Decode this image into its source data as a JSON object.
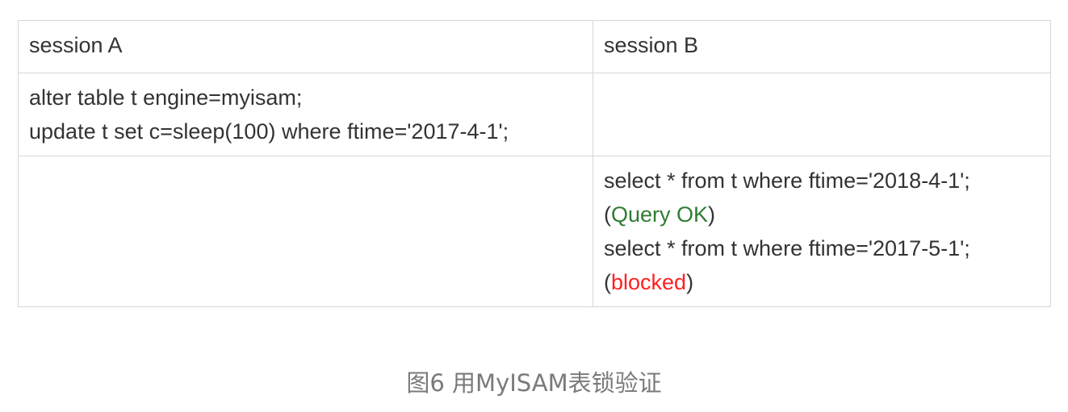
{
  "table": {
    "headers": [
      "session A",
      "session B"
    ],
    "row1": {
      "session_a": [
        "alter table t engine=myisam;",
        "update t set c=sleep(100)  where ftime='2017-4-1';"
      ],
      "session_b": []
    },
    "row2": {
      "session_a": [],
      "session_b": {
        "query1": "select * from t where  ftime='2018-4-1';",
        "result1": {
          "open": "(",
          "status": "Query OK",
          "close": ")"
        },
        "query2": "select * from t where  ftime='2017-5-1';",
        "result2": {
          "open": "(",
          "status": "blocked",
          "close": ")"
        }
      }
    }
  },
  "colors": {
    "ok": "#2e7d32",
    "blocked": "#ff2020",
    "border": "#d7d7d7",
    "text": "#333333",
    "caption": "#7a7a7a"
  },
  "caption": "图6 用MyISAM表锁验证"
}
